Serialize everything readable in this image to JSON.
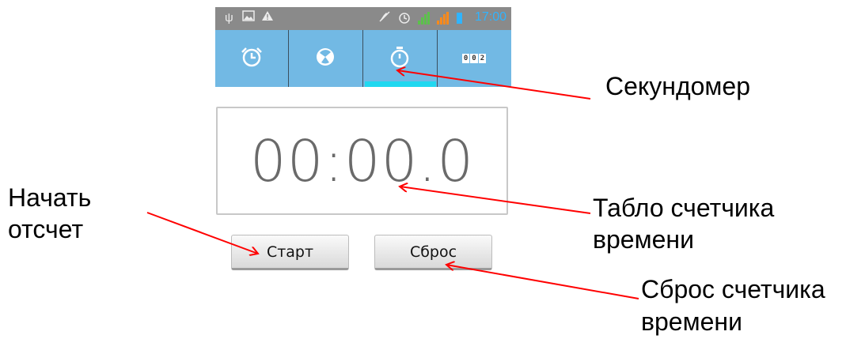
{
  "status_bar": {
    "time": "17:00",
    "icons": [
      "usb-icon",
      "image-icon",
      "warning-icon",
      "mute-icon",
      "alarm-icon",
      "signal-icon",
      "signal-icon",
      "battery-icon"
    ]
  },
  "tabs": [
    {
      "name": "alarm",
      "icon": "alarm-clock-icon"
    },
    {
      "name": "world-clock",
      "icon": "world-clock-icon"
    },
    {
      "name": "stopwatch",
      "icon": "stopwatch-icon",
      "selected": true
    },
    {
      "name": "timer",
      "icon": "timer-digits-icon",
      "digits": "002"
    }
  ],
  "stopwatch": {
    "time": "00:00.0",
    "start_label": "Старт",
    "reset_label": "Сброс"
  },
  "colors": {
    "status_bar": "#8a8a8a",
    "tab_bar": "#72b9e4",
    "tab_indicator": "#20d8f0",
    "arrow": "#ff0000",
    "clock_time": "#2fb4ff"
  },
  "annotations": {
    "stopwatch": "Секундомер",
    "display_line1": "Табло счетчика",
    "display_line2": "времени",
    "start_line1": "Начать",
    "start_line2": "отсчет",
    "reset_line1": "Сброс счетчика",
    "reset_line2": "времени"
  }
}
